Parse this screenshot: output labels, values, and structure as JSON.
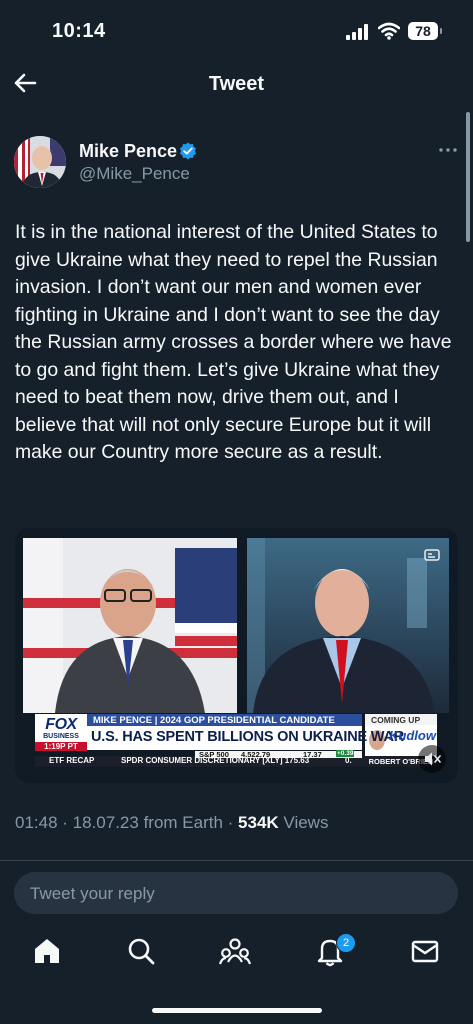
{
  "status_bar": {
    "time": "10:14",
    "battery": "78"
  },
  "header": {
    "title": "Tweet"
  },
  "author": {
    "name": "Mike Pence",
    "handle": "@Mike_Pence"
  },
  "tweet": {
    "text": "It is in the national interest of the United States to give Ukraine what they need to repel the Russian invasion. I don’t want our men and women ever fighting in Ukraine and I don’t want to see the day the Russian army crosses a border where we have to go and fight them. Let’s give Ukraine what they need to beat them now, drive them out, and I believe that will not only secure Europe but it will make our Country more secure as a result."
  },
  "video": {
    "channel_logo": "FOX",
    "channel_sub": "BUSINESS",
    "clock": "1:19P PT",
    "lower_third_title": "MIKE PENCE | 2024 GOP PRESIDENTIAL CANDIDATE",
    "headline": "U.S. HAS SPENT BILLIONS ON UKRAINE WAR",
    "coming_up": "COMING UP",
    "show_name": "Kudlow",
    "guest": "ROBERT O'BRIEN",
    "ticker_left": "ETF RECAP",
    "ticker_text": "SPDR CONSUMER DISCRETIONARY [XLY] 175.63",
    "ticker_change": "0.",
    "index_name": "S&P 500",
    "index_value": "4,522.79",
    "index_change": "17.37",
    "index_pct": "+0.39"
  },
  "meta": {
    "time": "01:48",
    "date": "18.07.23",
    "source": "from Earth",
    "views_count": "534K",
    "views_label": "Views"
  },
  "reply": {
    "placeholder": "Tweet your reply"
  },
  "notifications": {
    "count": "2"
  },
  "colors": {
    "background": "#15202b",
    "accent": "#1d9bf0",
    "secondary_text": "#8899a6"
  }
}
